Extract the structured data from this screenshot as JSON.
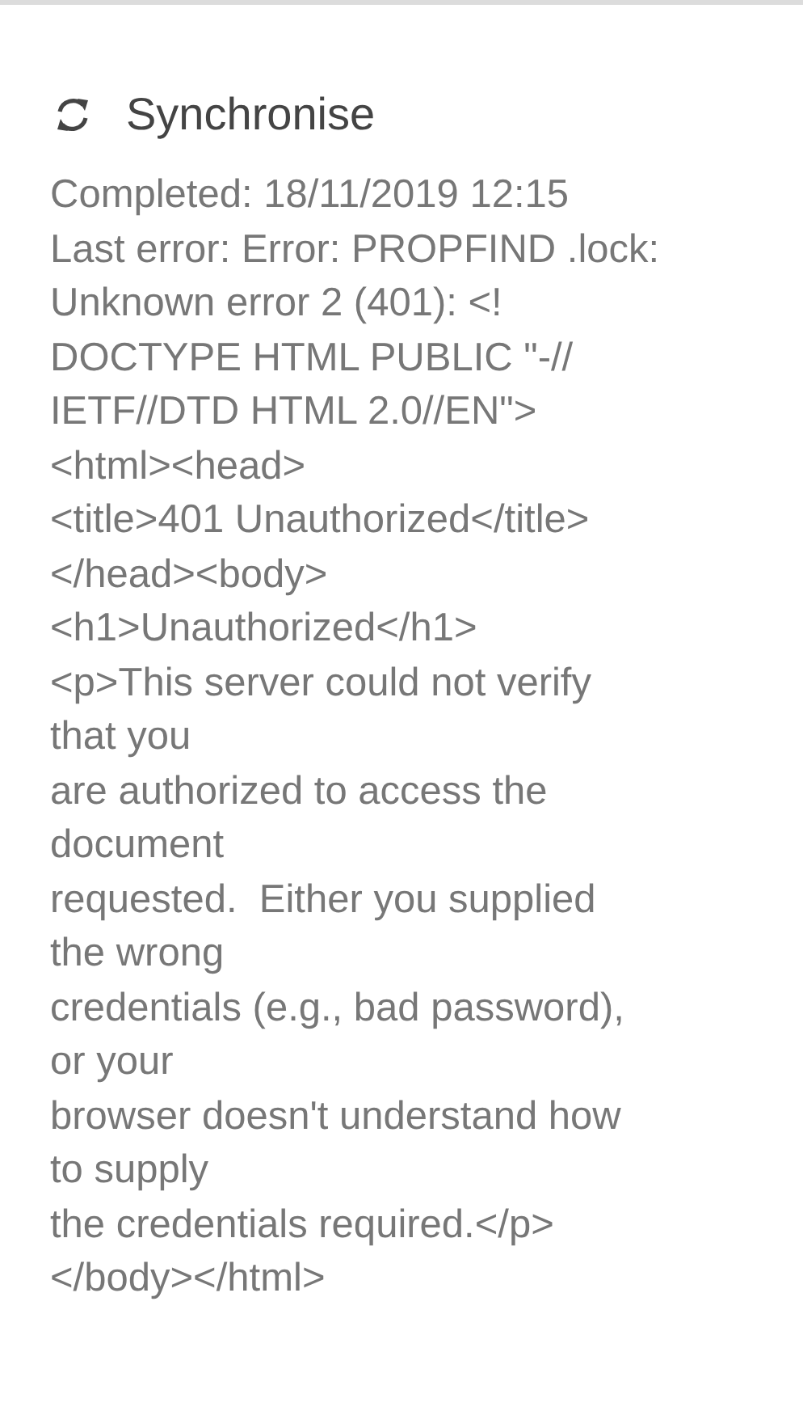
{
  "section": {
    "title": "Synchronise"
  },
  "status_lines": [
    "Completed: 18/11/2019 12:15",
    "Last error: Error: PROPFIND .lock:",
    "Unknown error 2 (401): <!",
    "DOCTYPE HTML PUBLIC \"-//",
    "IETF//DTD HTML 2.0//EN\">",
    "<html><head>",
    "<title>401 Unauthorized</title>",
    "</head><body>",
    "<h1>Unauthorized</h1>",
    "<p>This server could not verify",
    "that you",
    "are authorized to access the",
    "document",
    "requested.  Either you supplied",
    "the wrong",
    "credentials (e.g., bad password),",
    "or your",
    "browser doesn't understand how",
    "to supply",
    "the credentials required.</p>",
    "</body></html>"
  ]
}
